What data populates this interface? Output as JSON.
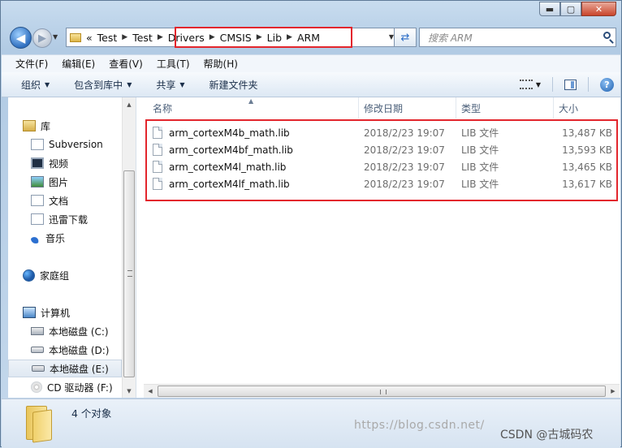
{
  "window": {
    "minimize_glyph": "▬",
    "maximize_glyph": "▢",
    "close_glyph": "✕"
  },
  "nav": {
    "back_glyph": "◀",
    "forward_glyph": "▶",
    "recent_glyph": "▼",
    "address": {
      "overflow": "«",
      "crumbs": [
        "Test",
        "Test",
        "Drivers",
        "CMSIS",
        "Lib",
        "ARM"
      ],
      "separator": "▶",
      "dropdown_glyph": "▼"
    },
    "refresh_glyph": "⇄",
    "search_placeholder": "搜索 ARM"
  },
  "menu": [
    "文件(F)",
    "编辑(E)",
    "查看(V)",
    "工具(T)",
    "帮助(H)"
  ],
  "toolbar": {
    "organize": "组织",
    "include_in_library": "包含到库中",
    "share": "共享",
    "new_folder": "新建文件夹",
    "dropdown_glyph": "▼",
    "help_glyph": "?"
  },
  "sidebar": {
    "items": [
      {
        "label": "库",
        "icon": "library-icon"
      },
      {
        "label": "Subversion",
        "icon": "subversion-icon"
      },
      {
        "label": "视频",
        "icon": "video-icon"
      },
      {
        "label": "图片",
        "icon": "pictures-icon"
      },
      {
        "label": "文档",
        "icon": "documents-icon"
      },
      {
        "label": "迅雷下载",
        "icon": "downloads-icon"
      },
      {
        "label": "音乐",
        "icon": "music-icon"
      },
      {
        "label": "家庭组",
        "icon": "homegroup-icon"
      },
      {
        "label": "计算机",
        "icon": "computer-icon"
      },
      {
        "label": "本地磁盘 (C:)",
        "icon": "drive-c-icon"
      },
      {
        "label": "本地磁盘 (D:)",
        "icon": "drive-icon"
      },
      {
        "label": "本地磁盘 (E:)",
        "icon": "drive-icon"
      },
      {
        "label": "CD 驱动器 (F:)",
        "icon": "cd-drive-icon"
      }
    ],
    "selected": "本地磁盘 (E:)",
    "scroll_up_glyph": "▲",
    "scroll_down_glyph": "▼"
  },
  "columns": {
    "name": "名称",
    "modified": "修改日期",
    "type": "类型",
    "size": "大小",
    "sort_glyph": "▲"
  },
  "files": [
    {
      "name": "arm_cortexM4b_math.lib",
      "modified": "2018/2/23 19:07",
      "type": "LIB 文件",
      "size": "13,487 KB"
    },
    {
      "name": "arm_cortexM4bf_math.lib",
      "modified": "2018/2/23 19:07",
      "type": "LIB 文件",
      "size": "13,593 KB"
    },
    {
      "name": "arm_cortexM4l_math.lib",
      "modified": "2018/2/23 19:07",
      "type": "LIB 文件",
      "size": "13,465 KB"
    },
    {
      "name": "arm_cortexM4lf_math.lib",
      "modified": "2018/2/23 19:07",
      "type": "LIB 文件",
      "size": "13,617 KB"
    }
  ],
  "hscroll": {
    "left_glyph": "◀",
    "right_glyph": "▶"
  },
  "status": {
    "count": "4 个对象",
    "watermark": "https://blog.csdn.net/",
    "csdn_tag": "CSDN @古城码农"
  },
  "colors": {
    "highlight": "#e3262d"
  }
}
